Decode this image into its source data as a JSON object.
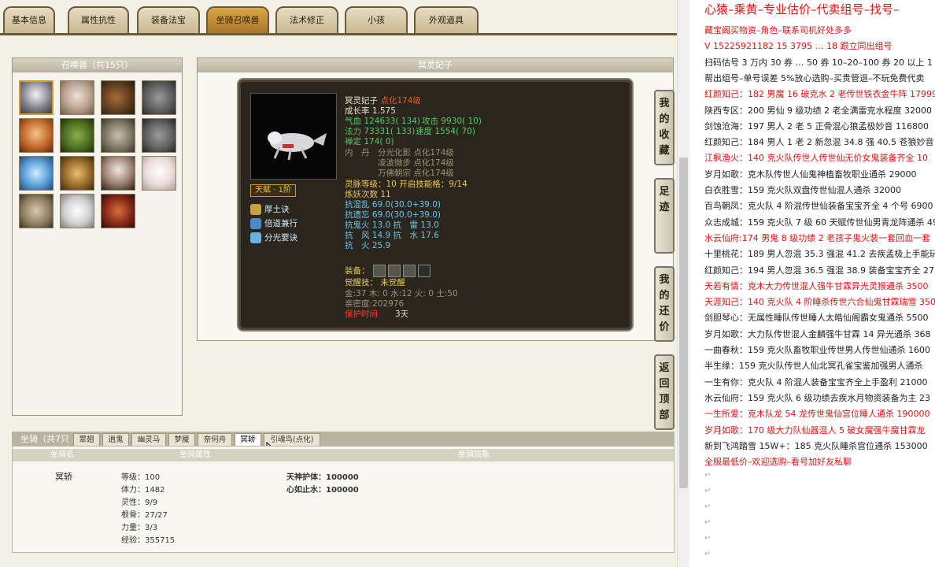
{
  "tabs": [
    "基本信息",
    "属性抗性",
    "装备法宝",
    "坐骑召唤兽",
    "法术修正",
    "小孩",
    "外观道具"
  ],
  "active_tab_index": 3,
  "summons": {
    "title": "召唤兽（共15只）"
  },
  "detail": {
    "title": "冥灵妃子",
    "name": "冥灵妃子",
    "name_suffix": "点化174级",
    "growth": "成长率 1.575",
    "hp": "气血 124633( 134)",
    "attack": "攻击 9930( 10)",
    "mp": "法力 73331( 133)",
    "speed": "速度 1554( 70)",
    "zen": "禅定 174( 0)",
    "dan_label": "内　丹",
    "dan1": "分光化影 点化174级",
    "dan2": "凌波微步 点化174级",
    "dan3": "万佛朝宗 点化174级",
    "spirit": "灵脉等级：10 开启技能格：9/14",
    "refine": "炼妖次数 11",
    "res": [
      "抗混乱 69.0(30.0+39.0)",
      "抗遗忘 69.0(30.0+39.0)",
      "抗鬼火 13.0 抗　雷 13.0",
      "抗　风 14.9 抗　水 17.6",
      "抗　火 25.9"
    ],
    "equip_label": "装备：",
    "awaken": "觉醒技： 未觉醒",
    "elements": "金:37 木: 0 水:12 火: 0 土:50",
    "intimacy": "亲密度:202976",
    "protect_label": "保护时间",
    "protect_value": "3天",
    "talent": "天赋 · 1阶",
    "skills": [
      "厚土诀",
      "倍道兼行",
      "分光要诀"
    ]
  },
  "side_buttons": [
    "我的收藏",
    "足迹",
    "我的还价",
    "返回顶部"
  ],
  "mount": {
    "tabs": [
      "坐骑（共7只",
      "翠翅",
      "逍鬼",
      "幽灵马",
      "梦魇",
      "奈何舟",
      "冥轿",
      "引魂鸟(点化)"
    ],
    "active_tab_index": 6,
    "headers": [
      "坐骑名",
      "坐骑属性",
      "坐骑技能"
    ],
    "name": "冥轿",
    "attrs": [
      "等级：100",
      "体力：1482",
      "灵性：9/9",
      "根骨：27/27",
      "力量：3/3",
      "经验：355715"
    ],
    "skills": [
      "天神护体：100000",
      "心如止水：100000"
    ]
  },
  "doc": {
    "title": "心猿–乘黄–专业估价–代卖组号–找号–",
    "lines": [
      {
        "t": "藏宝阁买物资–角色–联系司机好处多多",
        "r": true
      },
      {
        "t": "V 15225921182  15 3795 … 18 跟立同出组号",
        "r": true
      },
      {
        "t": "扫码估号 3 万内 30 券  … 50 券  10–20–100 券  20 以上 1",
        "r": false
      },
      {
        "t": "帮出组号–单号误差 5%放心选购–买贵管退–不玩免费代卖",
        "r": false
      },
      {
        "t": "红颜知己：182 男魔 16 破克水 2 老传世铁衣金牛阵 179994",
        "r": true
      },
      {
        "t": "陕西专区：200 男仙 9 级功绩 2 老全满雷克水程度 32000",
        "r": false
      },
      {
        "t": "剑蚀沧海：197 男人 2 老 5 正骨混心狼孟极妙音 116800",
        "r": false
      },
      {
        "t": "红颜知己：184 男人 1 老 2 新忽混 34.8 强 40.5 苍狼妙音 22",
        "r": false
      },
      {
        "t": "江枫渔火：140 克火队传世人传世仙无价女鬼装备齐全 10",
        "r": true
      },
      {
        "t": "岁月如歌：克木队传世人仙鬼神植畜牧职业通杀 29000",
        "r": false
      },
      {
        "t": "白衣胜雪：159 克火队双盘传世仙混人通杀 32000",
        "r": false
      },
      {
        "t": "百鸟朝凤：克火队 4 阶混传世仙装备宝宝齐全 4 个号 6900",
        "r": false
      },
      {
        "t": "众志成城：159 克火队 7 级 60 天赋传世仙男青龙阵通杀 49",
        "r": false
      },
      {
        "t": "水云仙府:174 男鬼 8 级功绩 2 老孩子鬼火装一套回血一套",
        "r": true
      },
      {
        "t": "十里桃花：189 男人忽混 35.3 强混 41.2 去疾孟极上手能玩",
        "r": false
      },
      {
        "t": "红颜知己：194 男人忽混 36.5 强混 38.9 装备宝宝齐全 2750",
        "r": false
      },
      {
        "t": "天若有情：克木大力传世混人强牛甘霖异光灵猴通杀 3500",
        "r": true
      },
      {
        "t": "天涯知己：140 克火队 4 阶睡杀传世六合仙鬼甘霖瑞雪 350",
        "r": true
      },
      {
        "t": "剑胆琴心：无属性睡队传世睡人太皓仙阁霸女鬼通杀 5500",
        "r": false
      },
      {
        "t": "岁月如歌：大力队传世混人金麟强牛甘霖 14 异光通杀 368",
        "r": false
      },
      {
        "t": "一曲春秋：159 克火队畜牧职业传世男人传世仙通杀 1600",
        "r": false
      },
      {
        "t": "半生缘：159 克火队传世人仙北冥孔雀宝鉴加强男人通杀",
        "r": false
      },
      {
        "t": "一生有你：克火队 4 阶混人装备宝宝齐全上手盈利 21000",
        "r": false
      },
      {
        "t": "水云仙府：159 克火队 6 级功绩去疾水月物资装备为主 23",
        "r": false
      },
      {
        "t": "一生所爱：克木队龙 54 龙传世鬼仙宫位睡人通杀 190000",
        "r": true
      },
      {
        "t": "岁月如歌：170 级大力队仙器混人 5 破女魔强牛魔甘霖龙",
        "r": true
      },
      {
        "t": "新到飞鸿踏雪 15W+：185 克火队睡杀宫位通杀 153000",
        "r": false
      },
      {
        "t": "全服最低价–欢迎选购–看号加好友私聊",
        "r": true
      }
    ]
  },
  "colors": {
    "accent": "#e01212",
    "tab_active": "#d9a64a",
    "card_bg": "#2b261d"
  }
}
